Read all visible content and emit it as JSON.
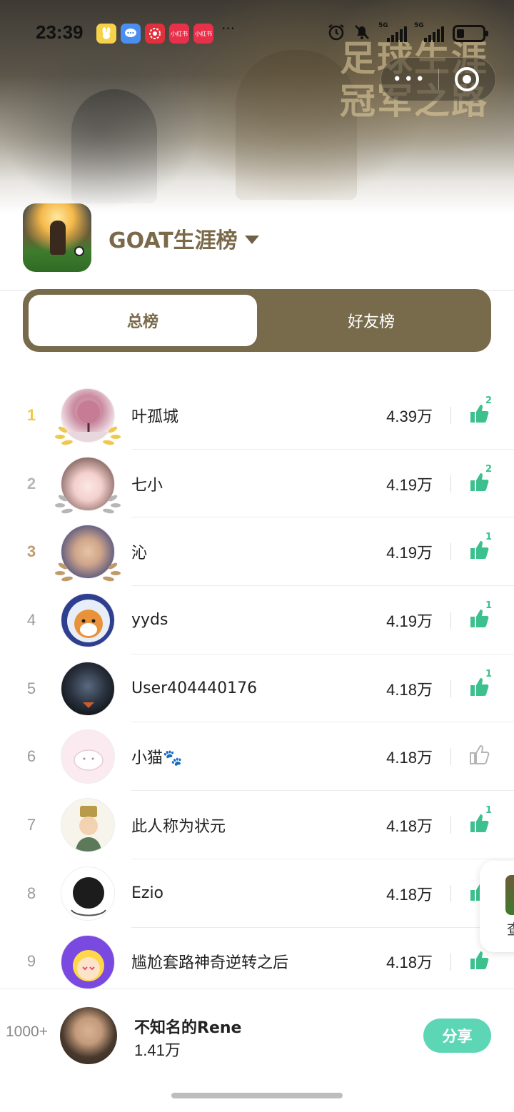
{
  "status_bar": {
    "time": "23:39",
    "apps": [
      {
        "icon": "bunny-app-icon",
        "label": "",
        "color": "#f5d24a"
      },
      {
        "icon": "chat-bubble-app-icon",
        "label": "",
        "color": "#4a8ff0"
      },
      {
        "icon": "flower-app-icon",
        "label": "",
        "color": "#e0303c"
      },
      {
        "icon": "xiaohongshu-app-icon",
        "label": "小红书",
        "color": "#e8304a"
      },
      {
        "icon": "xiaohongshu-app-icon",
        "label": "小红书",
        "color": "#e8304a"
      }
    ],
    "more": "···",
    "signal1_label": "5G",
    "signal2_label": "5G"
  },
  "banner": {
    "title_line1": "足球生涯",
    "title_line2": "冠军之路"
  },
  "capsule": {
    "more_label": "•••"
  },
  "header": {
    "board_title": "GOAT生涯榜"
  },
  "tabs": [
    {
      "label": "总榜",
      "active": true
    },
    {
      "label": "好友榜",
      "active": false
    }
  ],
  "rankings": [
    {
      "rank": "1",
      "name": "叶孤城",
      "score": "4.39万",
      "likes": "2",
      "liked": true,
      "medal": "gold",
      "avatar": "cherry-tree-avatar"
    },
    {
      "rank": "2",
      "name": "七小",
      "score": "4.19万",
      "likes": "2",
      "liked": true,
      "medal": "silver",
      "avatar": "anime-girl-avatar"
    },
    {
      "rank": "3",
      "name": "沁",
      "score": "4.19万",
      "likes": "1",
      "liked": true,
      "medal": "bronze",
      "avatar": "selfie-avatar"
    },
    {
      "rank": "4",
      "name": "yyds",
      "score": "4.19万",
      "likes": "1",
      "liked": true,
      "medal": "",
      "avatar": "shiba-avatar"
    },
    {
      "rank": "5",
      "name": "User404440176",
      "score": "4.18万",
      "likes": "1",
      "liked": true,
      "medal": "",
      "avatar": "robot-avatar"
    },
    {
      "rank": "6",
      "name": "小猫🐾",
      "score": "4.18万",
      "likes": "",
      "liked": false,
      "medal": "",
      "avatar": "cat-avatar"
    },
    {
      "rank": "7",
      "name": "此人称为状元",
      "score": "4.18万",
      "likes": "1",
      "liked": true,
      "medal": "",
      "avatar": "scholar-avatar"
    },
    {
      "rank": "8",
      "name": "Ezio",
      "score": "4.18万",
      "likes": "",
      "liked": true,
      "medal": "",
      "avatar": "dark-circle-avatar"
    },
    {
      "rank": "9",
      "name": "尴尬套路神奇逆转之后",
      "score": "4.18万",
      "likes": "",
      "liked": true,
      "medal": "",
      "avatar": "cartoon-avatar"
    }
  ],
  "side_card": {
    "label": "查"
  },
  "my_rank": {
    "rank": "1000+",
    "name": "不知名的Rene",
    "score": "1.41万",
    "share_label": "分享"
  },
  "colors": {
    "accent": "#786b4c",
    "like_green": "#3cc08e",
    "share_button": "#5dd6b6",
    "gold": "#f0c84c",
    "silver": "#b6b6b6",
    "bronze": "#c19a6b"
  }
}
